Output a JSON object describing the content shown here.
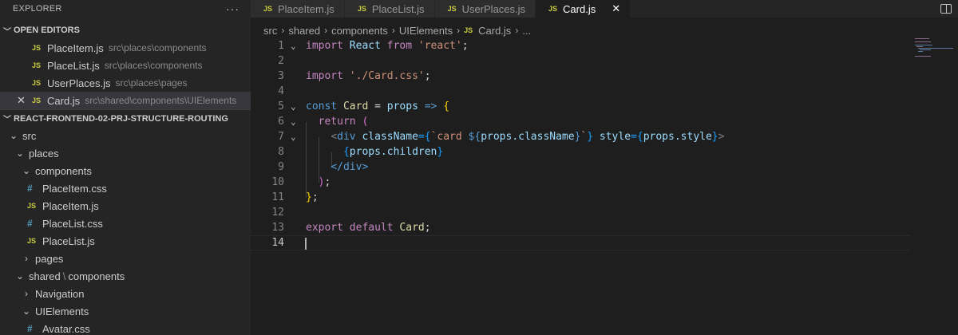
{
  "sidebar": {
    "title": "EXPLORER",
    "more_icon": "ellipsis-icon",
    "open_editors": {
      "label": "OPEN EDITORS",
      "items": [
        {
          "name": "PlaceItem.js",
          "path": "src\\places\\components"
        },
        {
          "name": "PlaceList.js",
          "path": "src\\places\\components"
        },
        {
          "name": "UserPlaces.js",
          "path": "src\\places\\pages"
        },
        {
          "name": "Card.js",
          "path": "src\\shared\\components\\UIElements",
          "active": true
        }
      ]
    },
    "project": {
      "label": "REACT-FRONTEND-02-PRJ-STRUCTURE-ROUTING",
      "tree": {
        "src": "src",
        "places": "places",
        "components": "components",
        "files": [
          "PlaceItem.css",
          "PlaceItem.js",
          "PlaceList.css",
          "PlaceList.js"
        ],
        "pages": "pages",
        "shared": "shared",
        "shared_sub": "components",
        "navigation": "Navigation",
        "uielements": "UIElements",
        "avatar_css": "Avatar.css"
      }
    }
  },
  "badges": {
    "js": "JS",
    "css": "#"
  },
  "tabs": [
    {
      "label": "PlaceItem.js"
    },
    {
      "label": "PlaceList.js"
    },
    {
      "label": "UserPlaces.js"
    },
    {
      "label": "Card.js",
      "active": true
    }
  ],
  "breadcrumb": [
    "src",
    "shared",
    "components",
    "UIElements",
    "Card.js",
    "..."
  ],
  "editor": {
    "line_numbers": [
      "1",
      "2",
      "3",
      "4",
      "5",
      "6",
      "7",
      "8",
      "9",
      "10",
      "11",
      "12",
      "13",
      "14"
    ],
    "current_line": "14",
    "code": {
      "l1": {
        "import": "import",
        "react": "React",
        "from": "from",
        "str": "'react'",
        "end": ";"
      },
      "l3": {
        "import": "import",
        "str": "'./Card.css'",
        "end": ";"
      },
      "l5": {
        "const": "const",
        "name": "Card",
        "eq": "=",
        "props": "props",
        "arrow": "=>",
        "brace": "{"
      },
      "l6": {
        "ret": "return",
        "paren": "("
      },
      "l7": {
        "lt": "<",
        "tag": "div",
        "attr": "className",
        "eqb": "={",
        "tpl_start": "`card ",
        "dollar": "${",
        "expr": "props.className",
        "close": "}",
        "tpl_end": "`",
        "cb": "}",
        "attr2": "style",
        "eqb2": "={",
        "expr2": "props.style",
        "cb2": "}",
        "gt": ">"
      },
      "l8": {
        "ob": "{",
        "expr": "props.children",
        "cb": "}"
      },
      "l9": {
        "tag": "</div>"
      },
      "l10": {
        "paren": ")",
        "semi": ";"
      },
      "l11": {
        "brace": "}",
        "semi": ";"
      },
      "l13": {
        "export": "export",
        "default": "default",
        "name": "Card",
        "semi": ";"
      }
    }
  },
  "colors": {
    "editor_bg": "#1e1e1e",
    "sidebar_bg": "#252526",
    "js_badge": "#cbcb41",
    "css_badge": "#519aba",
    "keyword": "#c586c0",
    "string": "#ce9178"
  }
}
